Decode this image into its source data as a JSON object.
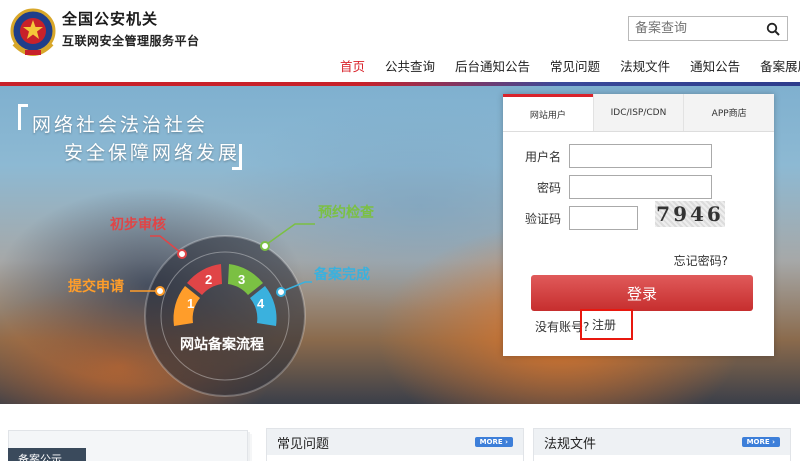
{
  "header": {
    "title": "全国公安机关",
    "subtitle": "互联网安全管理服务平台",
    "search_placeholder": "备案查询"
  },
  "nav": {
    "items": [
      "首页",
      "公共查询",
      "后台通知公告",
      "常见问题",
      "法规文件",
      "通知公告",
      "备案展厅"
    ],
    "active_index": 0
  },
  "hero": {
    "slogan_line1": "网络社会法治社会",
    "slogan_line2": "安全保障网络发展",
    "flow_title": "网站备案流程",
    "steps": [
      {
        "num": "1",
        "label": "提交申请",
        "color": "#ff9d2a"
      },
      {
        "num": "2",
        "label": "初步审核",
        "color": "#e04547"
      },
      {
        "num": "3",
        "label": "预约检查",
        "color": "#7bc043"
      },
      {
        "num": "4",
        "label": "备案完成",
        "color": "#3ab1de"
      }
    ]
  },
  "login": {
    "tabs": [
      "网站用户",
      "IDC/ISP/CDN",
      "APP商店"
    ],
    "active_tab": 0,
    "username_label": "用户名",
    "password_label": "密码",
    "captcha_label": "验证码",
    "captcha_text": "7946",
    "forgot_label": "忘记密码?",
    "login_button": "登录",
    "no_account_text": "没有账号?",
    "register_link": "注册"
  },
  "bottom": {
    "announce_tab": "备案公示",
    "panels": [
      {
        "title": "常见问题",
        "more": "MORE"
      },
      {
        "title": "法规文件",
        "more": "MORE"
      }
    ]
  },
  "colors": {
    "accent_red": "#d9232b",
    "nav_blue": "#2d3c8c",
    "login_button": "#d33a3a",
    "highlight_box": "#e8180f"
  }
}
